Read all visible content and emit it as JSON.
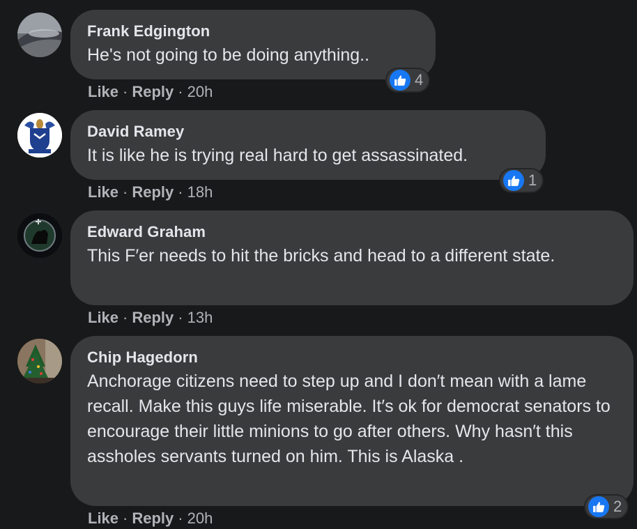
{
  "comments": [
    {
      "author": "Frank Edgington",
      "text": "He's not going to be doing anything..",
      "like_label": "Like",
      "reply_label": "Reply",
      "time": "20h",
      "reaction_count": "4"
    },
    {
      "author": "David Ramey",
      "text": "It is like he is trying real hard to get assassinated.",
      "like_label": "Like",
      "reply_label": "Reply",
      "time": "18h",
      "reaction_count": "1"
    },
    {
      "author": "Edward Graham",
      "text": "This F′er needs to hit the bricks and head to a different state.",
      "like_label": "Like",
      "reply_label": "Reply",
      "time": "13h",
      "reaction_count": ""
    },
    {
      "author": "Chip Hagedorn",
      "text": "Anchorage citizens need to step up and I don′t mean with a lame recall. Make this guys life miserable. It′s ok for democrat senators to encourage their little minions to go after others. Why hasn′t this assholes servants turned on him. This is Alaska .",
      "like_label": "Like",
      "reply_label": "Reply",
      "time": "20h",
      "reaction_count": "2"
    }
  ],
  "separator": "·",
  "colors": {
    "background": "#18191a",
    "bubble": "#3a3b3c",
    "like_blue": "#1877f2",
    "secondary_text": "#b0b3b8"
  }
}
